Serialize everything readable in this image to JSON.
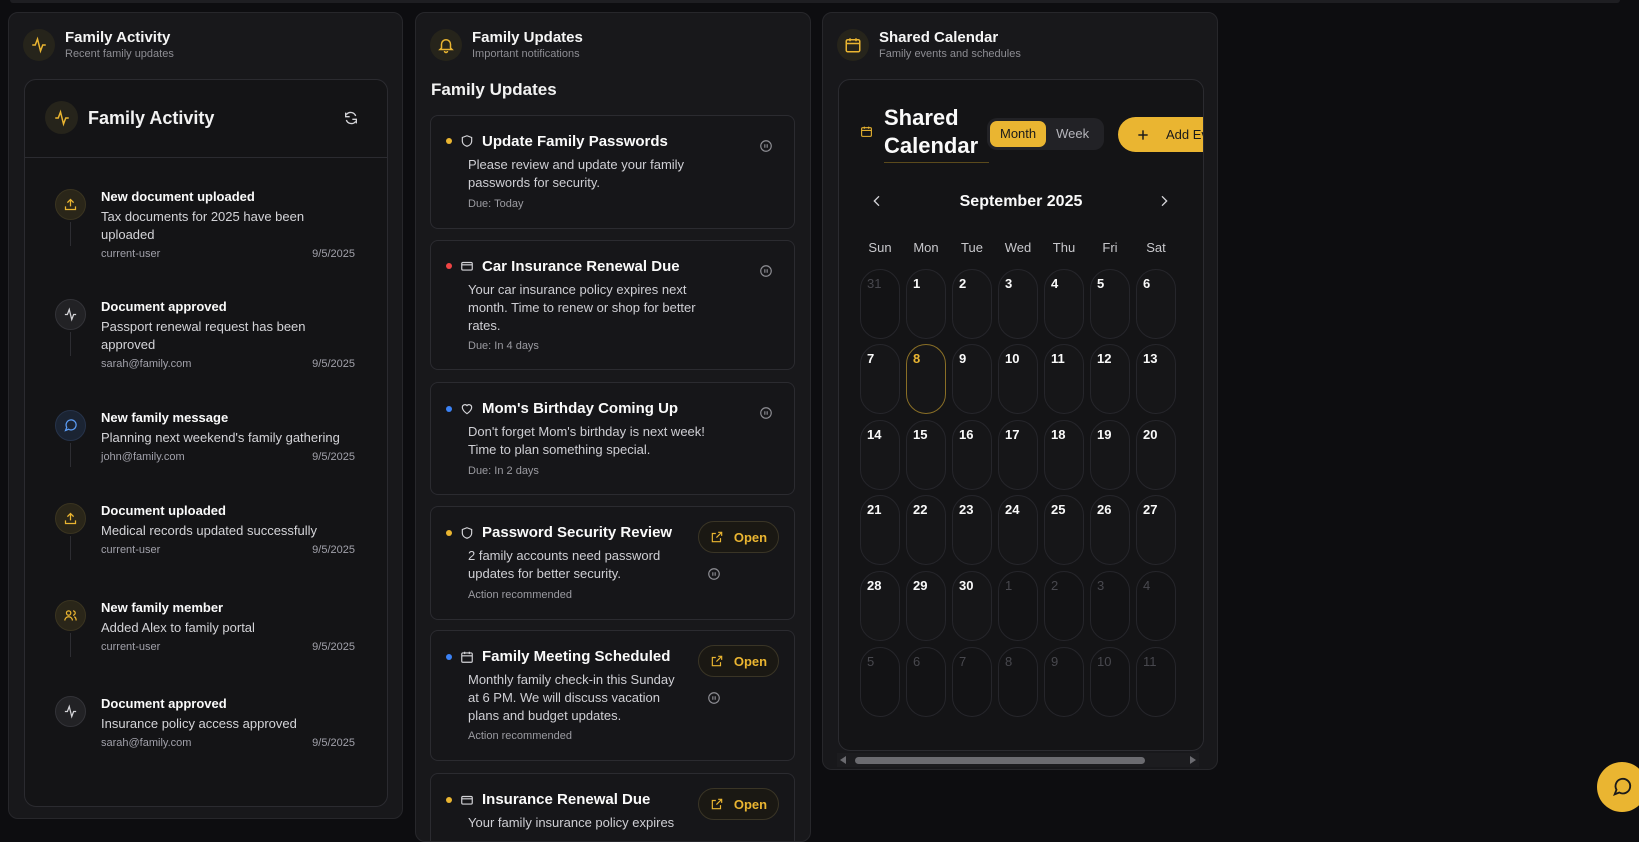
{
  "activity_card": {
    "title": "Family Activity",
    "subtitle": "Recent family updates",
    "inner_title": "Family Activity",
    "items": [
      {
        "title": "New document uploaded",
        "desc": "Tax documents for 2025 have been uploaded",
        "user": "current-user",
        "date": "9/5/2025",
        "icon": "upload-icon"
      },
      {
        "title": "Document approved",
        "desc": "Passport renewal request has been approved",
        "user": "sarah@family.com",
        "date": "9/5/2025",
        "icon": "activity-icon"
      },
      {
        "title": "New family message",
        "desc": "Planning next weekend's family gathering",
        "user": "john@family.com",
        "date": "9/5/2025",
        "icon": "message-icon"
      },
      {
        "title": "Document uploaded",
        "desc": "Medical records updated successfully",
        "user": "current-user",
        "date": "9/5/2025",
        "icon": "upload-icon"
      },
      {
        "title": "New family member",
        "desc": "Added Alex to family portal",
        "user": "current-user",
        "date": "9/5/2025",
        "icon": "users-icon"
      },
      {
        "title": "Document approved",
        "desc": "Insurance policy access approved",
        "user": "sarah@family.com",
        "date": "9/5/2025",
        "icon": "activity-icon"
      }
    ]
  },
  "updates_card": {
    "title": "Family Updates",
    "subtitle": "Important notifications",
    "section_title": "Family Updates",
    "open_label": "Open",
    "items": [
      {
        "title": "Update Family Passwords",
        "desc": "Please review and update your family passwords for security.",
        "footer": "Due: Today",
        "dot": "#eab531",
        "icon": "shield-icon"
      },
      {
        "title": "Car Insurance Renewal Due",
        "desc": "Your car insurance policy expires next month. Time to renew or shop for better rates.",
        "footer": "Due: In 4 days",
        "dot": "#ef4444",
        "icon": "card-icon"
      },
      {
        "title": "Mom's Birthday Coming Up",
        "desc": "Don't forget Mom's birthday is next week! Time to plan something special.",
        "footer": "Due: In 2 days",
        "dot": "#3b82f6",
        "icon": "heart-icon"
      },
      {
        "title": "Password Security Review",
        "desc": "2 family accounts need password updates for better security.",
        "footer": "Action recommended",
        "dot": "#eab531",
        "icon": "shield-icon"
      },
      {
        "title": "Family Meeting Scheduled",
        "desc": "Monthly family check-in this Sunday at 6 PM. We will discuss vacation plans and budget updates.",
        "footer": "Action recommended",
        "dot": "#3b82f6",
        "icon": "calendar-icon"
      },
      {
        "title": "Insurance Renewal Due",
        "desc": "Your family insurance policy expires",
        "footer": "",
        "dot": "#eab531",
        "icon": "card-icon"
      }
    ]
  },
  "calendar_card": {
    "title": "Shared Calendar",
    "subtitle": "Family events and schedules",
    "cal_title": "Shared Calendar",
    "view_month": "Month",
    "view_week": "Week",
    "add_event": "Add Ev",
    "month_label": "September 2025",
    "weekdays": [
      "Sun",
      "Mon",
      "Tue",
      "Wed",
      "Thu",
      "Fri",
      "Sat"
    ],
    "days": [
      "31",
      "1",
      "2",
      "3",
      "4",
      "5",
      "6",
      "7",
      "8",
      "9",
      "10",
      "11",
      "12",
      "13",
      "14",
      "15",
      "16",
      "17",
      "18",
      "19",
      "20",
      "21",
      "22",
      "23",
      "24",
      "25",
      "26",
      "27",
      "28",
      "29",
      "30",
      "1",
      "2",
      "3",
      "4",
      "5",
      "6",
      "7",
      "8",
      "9",
      "10",
      "11"
    ],
    "today": "8"
  },
  "colors": {
    "accent": "#eab531",
    "background": "#0d0d10",
    "card": "#18181b"
  }
}
